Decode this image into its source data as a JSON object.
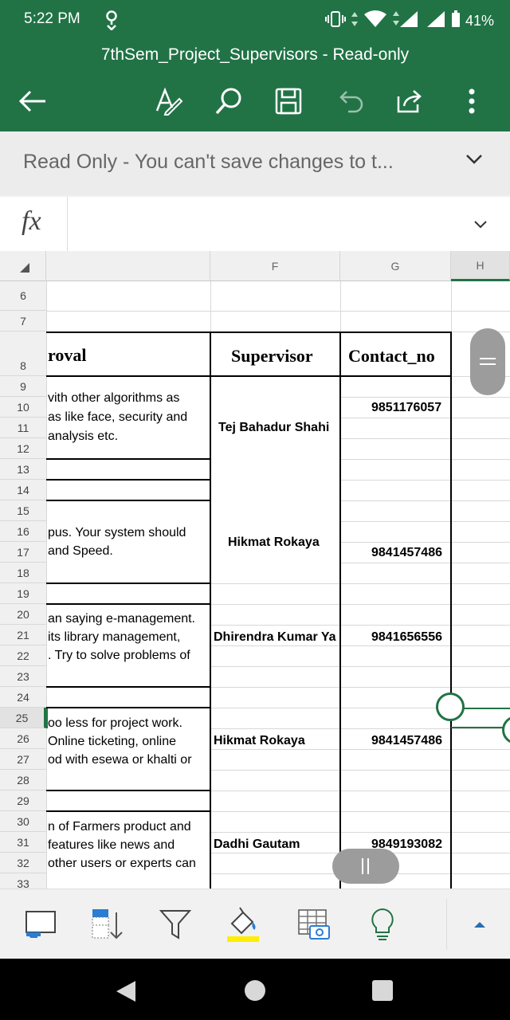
{
  "status_bar": {
    "time": "5:22 PM",
    "battery": "41%"
  },
  "title_bar": {
    "doc_title": "7thSem_Project_Supervisors - Read-only"
  },
  "read_only_bar": {
    "message": "Read Only - You can't save changes to t..."
  },
  "formula_bar": {
    "fx_label": "fx",
    "value": ""
  },
  "columns": {
    "F": "F",
    "G": "G",
    "H": "H"
  },
  "rows": [
    "6",
    "7",
    "8",
    "9",
    "10",
    "11",
    "12",
    "13",
    "14",
    "15",
    "16",
    "17",
    "18",
    "19",
    "20",
    "21",
    "22",
    "23",
    "24",
    "25",
    "26",
    "27",
    "28",
    "29",
    "30",
    "31",
    "32",
    "33"
  ],
  "table": {
    "header_approval": "roval",
    "header_supervisor": "Supervisor",
    "header_contact": "Contact_no",
    "entries": [
      {
        "desc": [
          "vith other algorithms as",
          "as like face, security and",
          "analysis etc."
        ],
        "supervisor": "Tej Bahadur Shahi",
        "contact": "9851176057"
      },
      {
        "desc": [
          "pus. Your system should",
          "and Speed."
        ],
        "supervisor": "Hikmat Rokaya",
        "contact": "9841457486"
      },
      {
        "desc": [
          "an saying e-management.",
          "its library management,",
          ". Try to solve problems of"
        ],
        "supervisor": "Dhirendra Kumar Ya",
        "contact": "9841656556"
      },
      {
        "desc": [
          "oo less for project work.",
          "Online ticketing, online",
          "od with esewa or khalti or"
        ],
        "supervisor": "Hikmat Rokaya",
        "contact": "9841457486"
      },
      {
        "desc": [
          "n of Farmers product and",
          "features like news and",
          "other users or experts can"
        ],
        "supervisor": "Dadhi Gautam",
        "contact": "9849193082"
      }
    ]
  },
  "colors": {
    "excel_green": "#217346",
    "highlight_yellow": "#ffee00"
  },
  "bottom_toolbar": {
    "icons": [
      "select-sheet-icon",
      "sort-icon",
      "filter-icon",
      "fill-color-icon",
      "table-camera-icon",
      "lightbulb-icon",
      "expand-icon"
    ]
  }
}
